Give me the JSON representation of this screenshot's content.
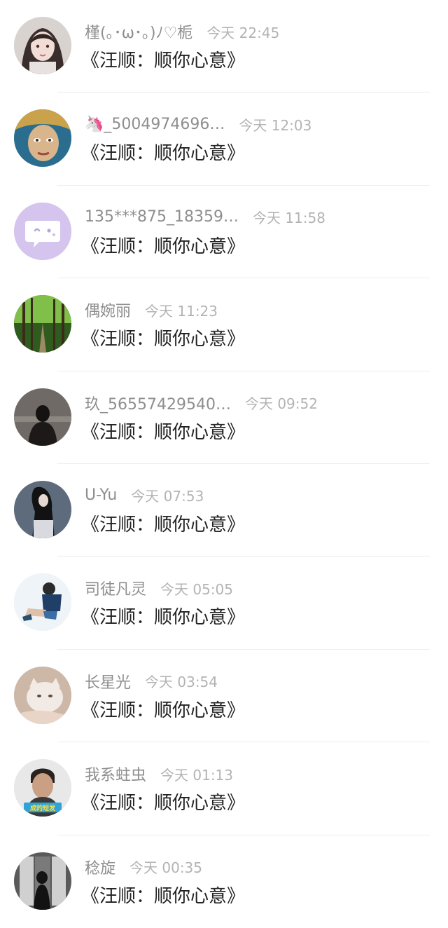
{
  "items": [
    {
      "name": "槿(｡･ω･｡)ﾉ♡栀",
      "time": "今天 22:45",
      "message": "《汪顺：顺你心意》",
      "avatar": "avatar-girl-cartoon"
    },
    {
      "name": "🦄_5004974696…",
      "time": "今天 12:03",
      "message": "《汪顺：顺你心意》",
      "avatar": "avatar-painted-face"
    },
    {
      "name": "135***875_18359…",
      "time": "今天 11:58",
      "message": "《汪顺：顺你心意》",
      "avatar": "avatar-default-purple"
    },
    {
      "name": "偶婉丽",
      "time": "今天 11:23",
      "message": "《汪顺：顺你心意》",
      "avatar": "avatar-forest-road"
    },
    {
      "name": "玖_56557429540…",
      "time": "今天 09:52",
      "message": "《汪顺：顺你心意》",
      "avatar": "avatar-silhouette-sea"
    },
    {
      "name": "U-Yu",
      "time": "今天 07:53",
      "message": "《汪顺：顺你心意》",
      "avatar": "avatar-girl-long-hair"
    },
    {
      "name": "司徒凡灵",
      "time": "今天 05:05",
      "message": "《汪顺：顺你心意》",
      "avatar": "avatar-sitting-figure"
    },
    {
      "name": "长星光",
      "time": "今天 03:54",
      "message": "《汪顺：顺你心意》",
      "avatar": "avatar-cat"
    },
    {
      "name": "我系蛀虫",
      "time": "今天 01:13",
      "message": "《汪顺：顺你心意》",
      "avatar": "avatar-man-portrait"
    },
    {
      "name": "稔旋",
      "time": "今天 00:35",
      "message": "《汪顺：顺你心意》",
      "avatar": "avatar-window-silhouette"
    }
  ],
  "avatar_labels": {
    "man_portrait_caption": "成的短发"
  }
}
